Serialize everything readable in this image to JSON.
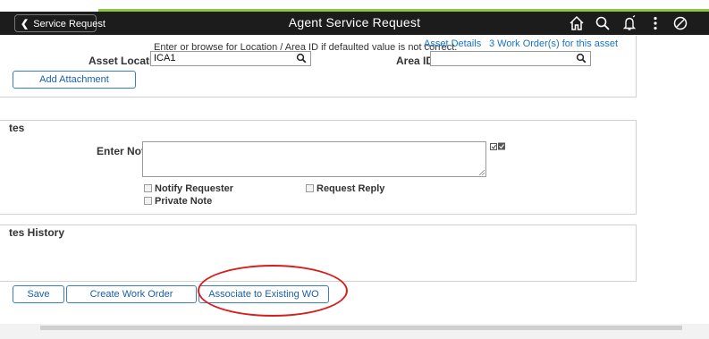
{
  "header": {
    "back_label": "Service Request",
    "title": "Agent Service Request",
    "icons": [
      "home-icon",
      "search-icon",
      "notification-icon",
      "more-options-icon",
      "circle-slash-icon"
    ]
  },
  "location_section": {
    "hint": "Enter or browse for Location / Area ID if defaulted value is not correct.",
    "asset_details_link": "Asset Details",
    "work_orders_link": "3 Work Order(s) for this asset",
    "asset_location_label": "Asset Location",
    "asset_location_value": "ICA1",
    "area_id_label": "Area ID",
    "area_id_value": "",
    "add_attachment_label": "Add Attachment"
  },
  "notes_section": {
    "title": "tes",
    "enter_note_label": "Enter Note",
    "note_value": "",
    "notify_requester_label": "Notify Requester",
    "request_reply_label": "Request Reply",
    "private_note_label": "Private Note"
  },
  "notes_history": {
    "title": "tes History"
  },
  "footer_buttons": {
    "save": "Save",
    "create_work_order": "Create Work Order",
    "associate": "Associate to Existing WO"
  },
  "colors": {
    "header_bg": "#1c1c1c",
    "accent_green": "#8ec63f",
    "link_blue": "#1a73c0",
    "highlight_red": "#d91c1c"
  }
}
